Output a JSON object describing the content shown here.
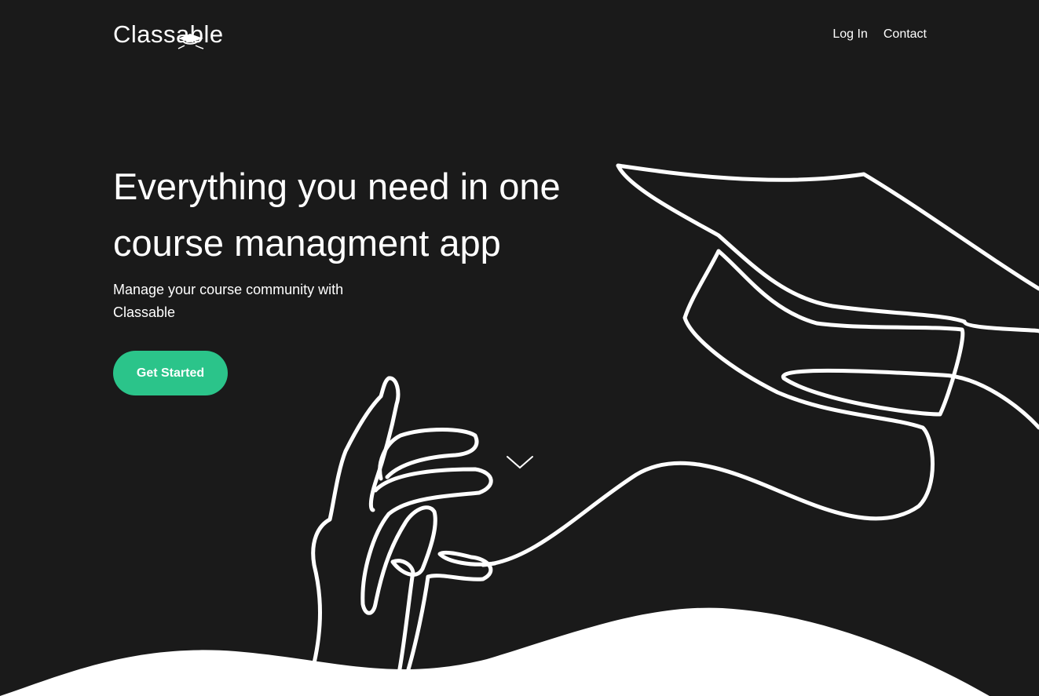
{
  "header": {
    "logo_text": "Classable",
    "logo_icon": "graduation-cap-icon",
    "nav": [
      {
        "label": "Log In"
      },
      {
        "label": "Contact"
      }
    ]
  },
  "hero": {
    "title": "Everything you need in one course managment app",
    "subtitle": "Manage your course community with Classable",
    "cta_label": "Get Started",
    "scroll_icon": "chevron-down-icon"
  },
  "colors": {
    "background": "#1a1a1a",
    "accent": "#2bc48a",
    "text": "#ffffff",
    "wave": "#ffffff"
  }
}
